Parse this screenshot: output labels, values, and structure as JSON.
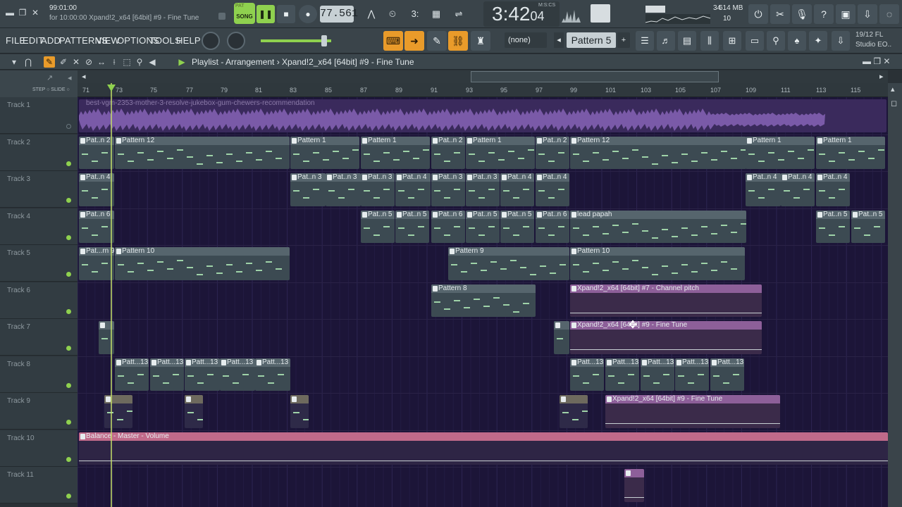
{
  "window": {
    "hint_line1": "99:01:00",
    "hint_line2": "for 10:00:00 Xpand!2_x64 [64bit] #9 - Fine Tune"
  },
  "transport": {
    "pat_label": "PAT",
    "song_label": "SONG",
    "tempo": "77.561",
    "time": "3:42",
    "time_sub": "04",
    "time_unit": "M:S:CS",
    "cpu": "34",
    "memory": "614 MB",
    "polyphony": "10"
  },
  "menu": [
    "FILE",
    "EDIT",
    "ADD",
    "PATTERNS",
    "VIEW",
    "OPTIONS",
    "TOOLS",
    "HELP"
  ],
  "toolbar": {
    "snap": "(none)",
    "pattern": "Pattern 5",
    "pattern_add": "+",
    "news_date": "19/12  FL",
    "news_title": "Studio EO.."
  },
  "playlist": {
    "title": "Playlist - Arrangement › Xpand!2_x64 [64bit] #9 - Fine Tune",
    "step_label": "STEP",
    "slide_label": "SLIDE",
    "ruler_ticks": [
      "71",
      "73",
      "75",
      "77",
      "79",
      "81",
      "83",
      "85",
      "87",
      "89",
      "91",
      "93",
      "95",
      "97",
      "99",
      "101",
      "103",
      "105",
      "107",
      "109",
      "111",
      "113",
      "115"
    ],
    "tracks": [
      "Track 1",
      "Track 2",
      "Track 3",
      "Track 4",
      "Track 5",
      "Track 6",
      "Track 7",
      "Track 8",
      "Track 9",
      "Track 10",
      "Track 11"
    ]
  },
  "clips": {
    "audio_title": "best-vgm-2353-mother-3-resolve-jukebox-gum-chewers-recommendation",
    "t2": [
      "Pat..n 2",
      "Pattern 12",
      "Pattern 1",
      "Pattern 1",
      "Pat..n 2",
      "Pattern 1",
      "Pat..n 2",
      "Pattern 12",
      "Pattern 1",
      "Pattern 1"
    ],
    "t3": [
      "Pat..n 4",
      "Pat..n 3",
      "Pat..n 3",
      "Pat..n 3",
      "Pat..n 4",
      "Pat..n 3",
      "Pat..n 3",
      "Pat..n 4",
      "Pat..n 4",
      "Pat..n 4",
      "Pat..n 4",
      "Pat..n 4"
    ],
    "t4": [
      "Pat..n 6",
      "Pat..n 5",
      "Pat..n 5",
      "Pat..n 6",
      "Pat..n 5",
      "Pat..n 5",
      "Pat..n 6",
      "lead papah",
      "Pat..n 5",
      "Pat..n 5"
    ],
    "t5": [
      "Pat...rn 9",
      "Pattern 10",
      "Pattern 9",
      "Pattern 10"
    ],
    "t6": [
      "Pattern 8",
      "Xpand!2_x64 [64bit] #7 - Channel pitch"
    ],
    "t7": [
      "Xpand!2_x64 [64bit] #9 - Fine Tune"
    ],
    "t8": [
      "Patt...13",
      "Patt...13",
      "Patt...13",
      "Patt...13",
      "Patt...13",
      "Patt...13",
      "Patt...13",
      "Patt...13",
      "Patt...13",
      "Patt...13"
    ],
    "t9": [
      "Xpand!2_x64 [64bit] #9 - Fine Tune"
    ],
    "t10": [
      "Balance - Master - Volume"
    ]
  }
}
